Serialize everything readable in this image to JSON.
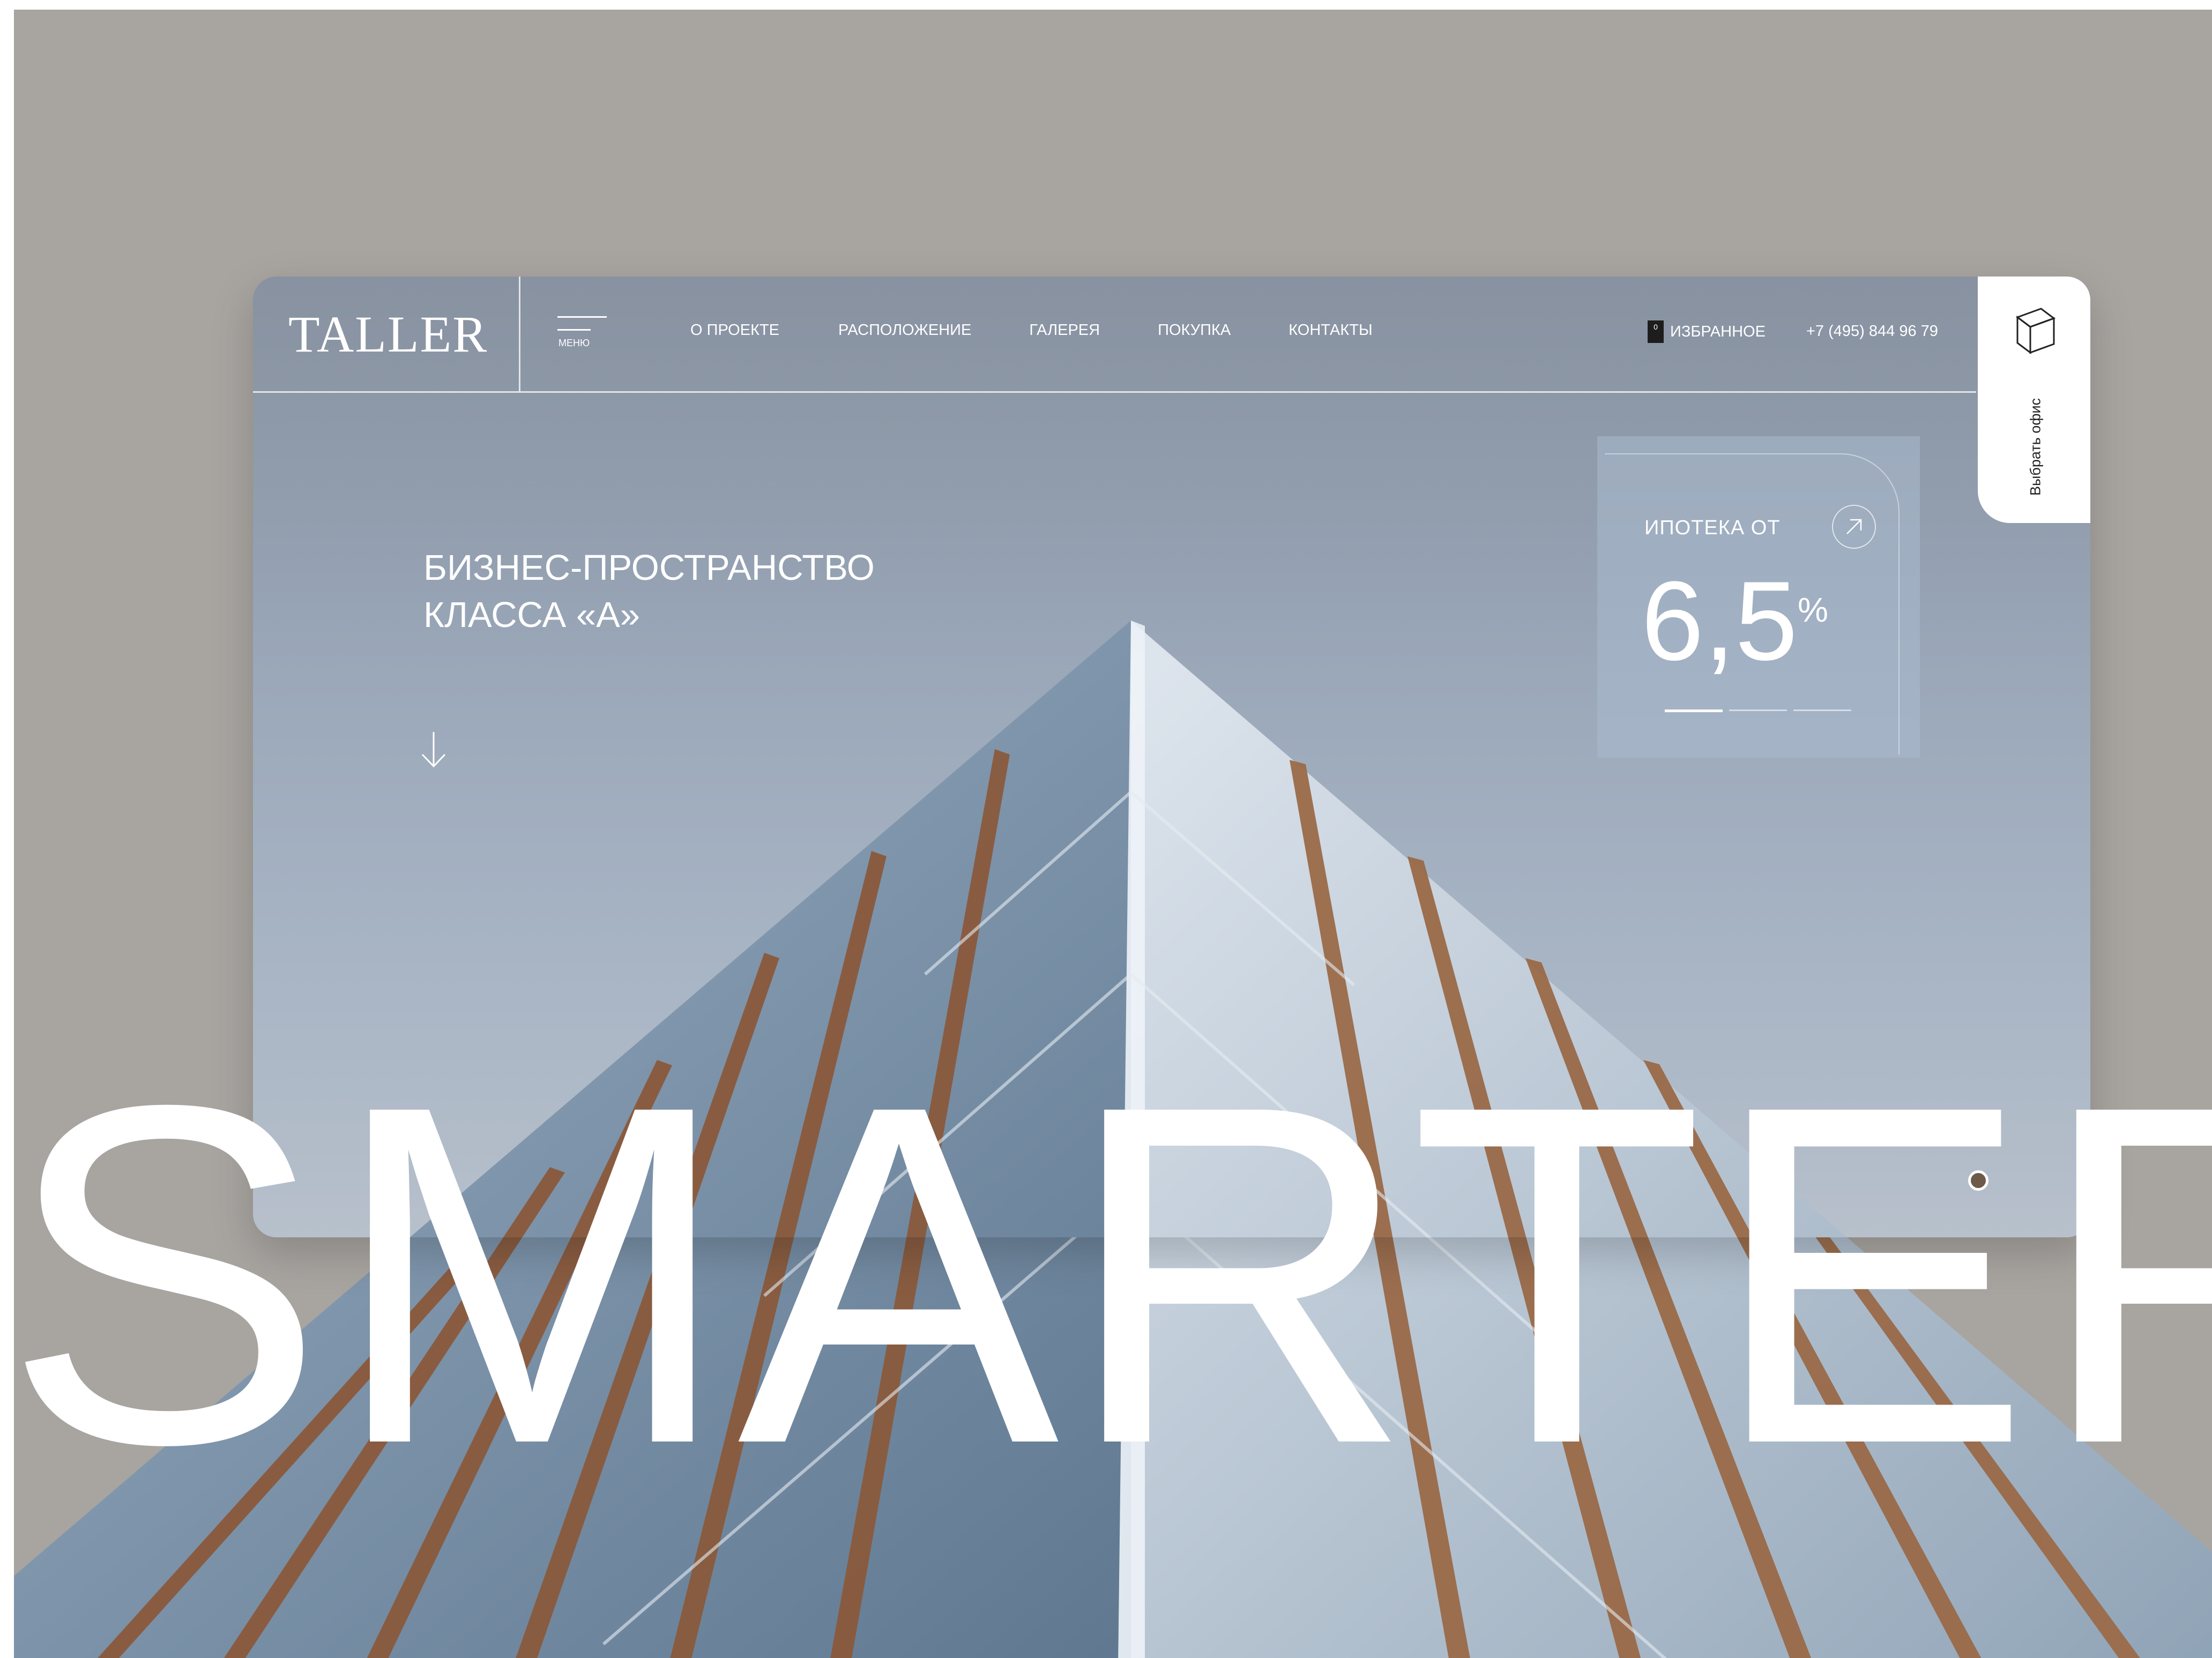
{
  "header": {
    "logo": "TALLER",
    "menu_label": "МЕНЮ",
    "nav": [
      "О ПРОЕКТЕ",
      "РАСПОЛОЖЕНИЕ",
      "ГАЛЕРЕЯ",
      "ПОКУПКА",
      "КОНТАКТЫ"
    ],
    "favorites": {
      "count": "0",
      "label": "ИЗБРАННОЕ"
    },
    "phone": "+7 (495) 844 96 79"
  },
  "side_tab": {
    "label": "Выбрать офис",
    "icon": "cube-icon"
  },
  "hero": {
    "title_line1": "БИЗНЕС-ПРОСТРАНСТВО",
    "title_line2": "КЛАССА «А»",
    "scroll_icon": "arrow-down-icon"
  },
  "mortgage": {
    "label": "ИПОТЕКА ОТ",
    "value": "6,5",
    "unit": "%",
    "slides_total": 3,
    "active_slide": 1
  },
  "overlay_word": "SMARTER",
  "colors": {
    "backdrop": "#a8a4a0",
    "sky": "#98a5b6",
    "text": "#ffffff",
    "side_tab": "#ffffff",
    "copper": "#8a5a3c"
  }
}
